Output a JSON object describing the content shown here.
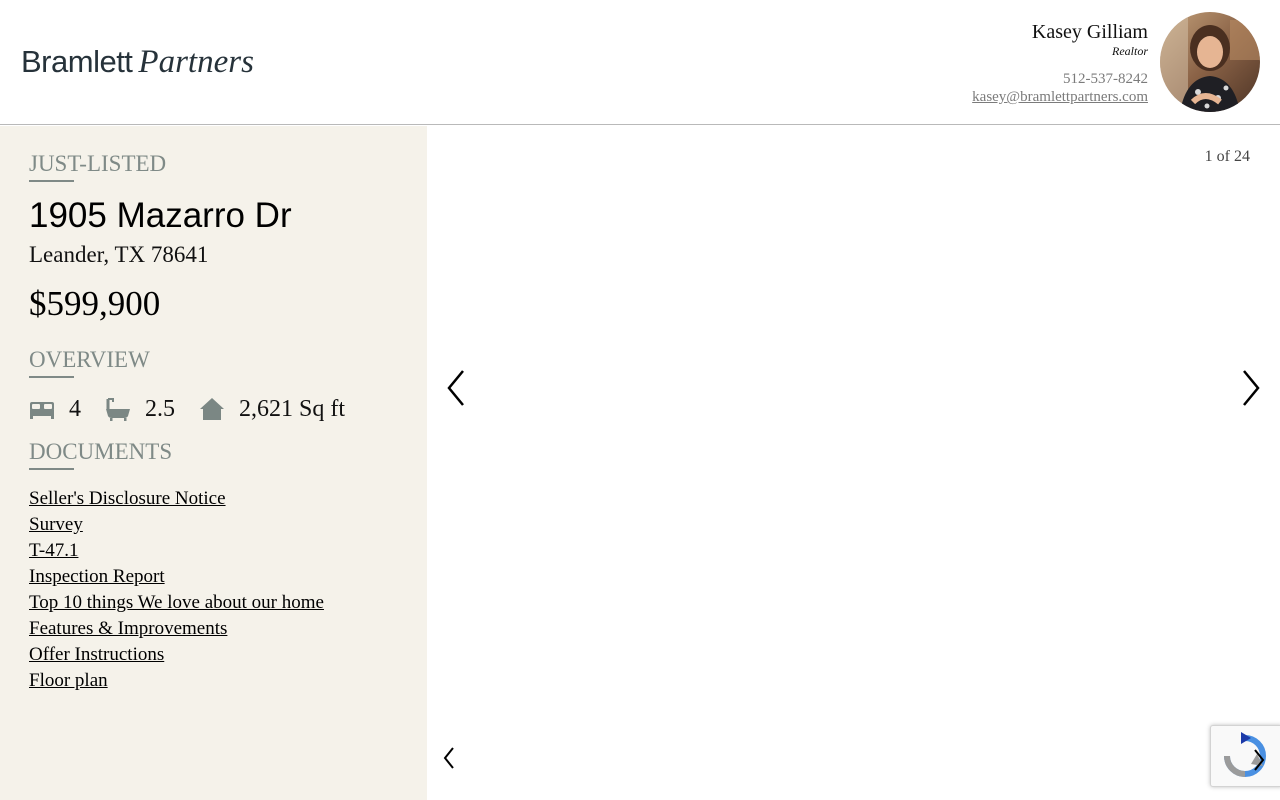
{
  "header": {
    "logo_part1": "Bramlett",
    "logo_part2": "Partners",
    "agent": {
      "name": "Kasey Gilliam",
      "title": "Realtor",
      "phone": "512-537-8242",
      "email": "kasey@bramlettpartners.com"
    }
  },
  "listing": {
    "status": "JUST-LISTED",
    "address_line1": "1905 Mazarro Dr",
    "address_line2": "Leander, TX 78641",
    "price": "$599,900",
    "overview_heading": "OVERVIEW",
    "beds": "4",
    "baths": "2.5",
    "sqft": "2,621 Sq ft",
    "documents_heading": "DOCUMENTS",
    "documents": [
      "Seller's Disclosure Notice",
      "Survey",
      "T-47.1",
      "Inspection Report",
      "Top 10 things We love about our home",
      "Features & Improvements",
      "Offer Instructions",
      "Floor plan"
    ]
  },
  "gallery": {
    "counter": "1 of 24"
  },
  "icons": {
    "bed": "bed-icon",
    "bath": "bath-icon",
    "home": "home-icon",
    "prev": "chevron-left-icon",
    "next": "chevron-right-icon"
  },
  "colors": {
    "sidebar_bg": "#f5f2ea",
    "heading_gray": "#7f8a87",
    "logo": "#26323a"
  }
}
